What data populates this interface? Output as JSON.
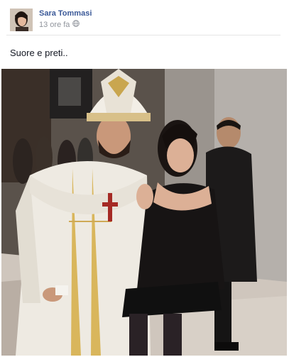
{
  "post": {
    "author_name": "Sara Tommasi",
    "timestamp": "13 ore fa",
    "privacy_icon": "globe-icon",
    "text": "Suore e preti..",
    "photo_icon": "photo"
  }
}
